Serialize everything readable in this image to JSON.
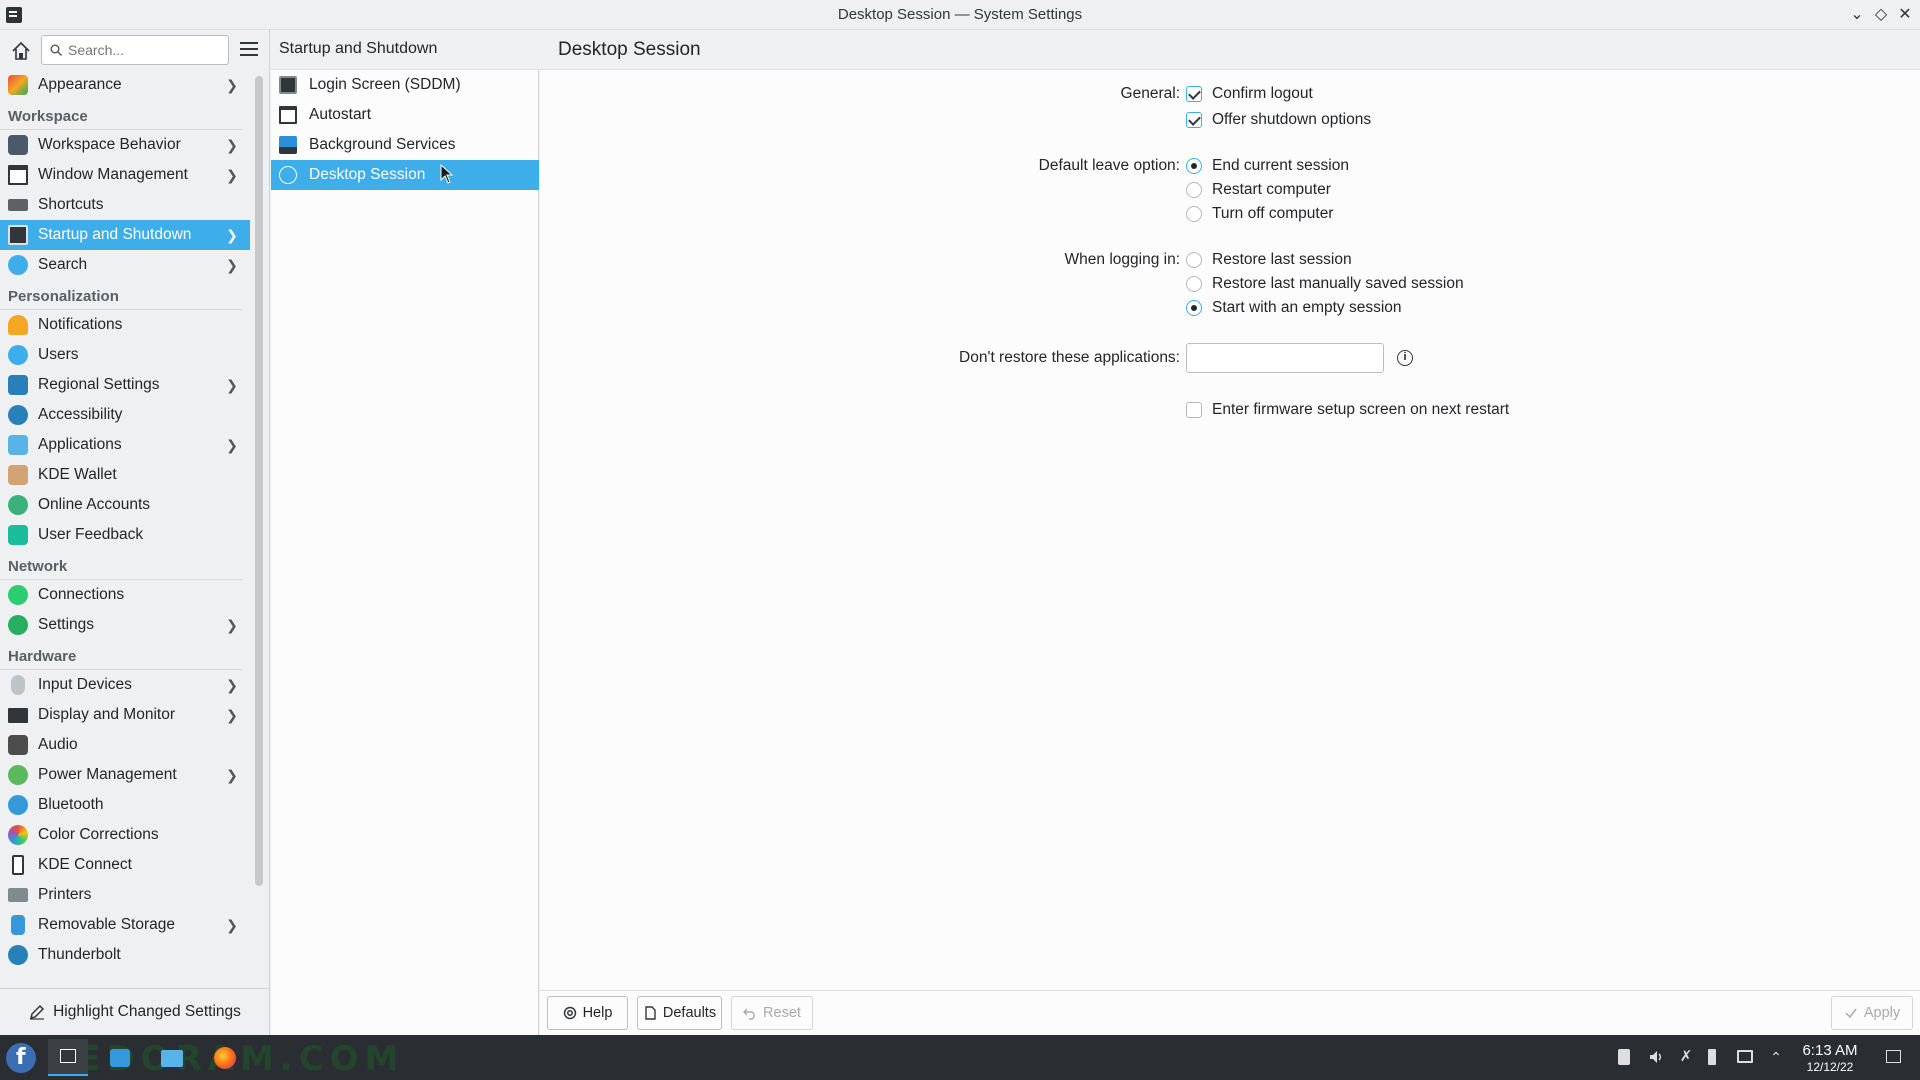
{
  "window": {
    "title": "Desktop Session — System Settings"
  },
  "search": {
    "placeholder": "Search..."
  },
  "sidebar": {
    "top_item": {
      "label": "Appearance"
    },
    "sections": {
      "workspace": "Workspace",
      "personalization": "Personalization",
      "network": "Network",
      "hardware": "Hardware"
    },
    "workspace_items": [
      {
        "label": "Workspace Behavior"
      },
      {
        "label": "Window Management"
      },
      {
        "label": "Shortcuts"
      },
      {
        "label": "Startup and Shutdown"
      },
      {
        "label": "Search"
      }
    ],
    "personalization_items": [
      {
        "label": "Notifications"
      },
      {
        "label": "Users"
      },
      {
        "label": "Regional Settings"
      },
      {
        "label": "Accessibility"
      },
      {
        "label": "Applications"
      },
      {
        "label": "KDE Wallet"
      },
      {
        "label": "Online Accounts"
      },
      {
        "label": "User Feedback"
      }
    ],
    "network_items": [
      {
        "label": "Connections"
      },
      {
        "label": "Settings"
      }
    ],
    "hardware_items": [
      {
        "label": "Input Devices"
      },
      {
        "label": "Display and Monitor"
      },
      {
        "label": "Audio"
      },
      {
        "label": "Power Management"
      },
      {
        "label": "Bluetooth"
      },
      {
        "label": "Color Corrections"
      },
      {
        "label": "KDE Connect"
      },
      {
        "label": "Printers"
      },
      {
        "label": "Removable Storage"
      },
      {
        "label": "Thunderbolt"
      }
    ],
    "footer_label": "Highlight Changed Settings"
  },
  "category": {
    "title": "Startup and Shutdown",
    "items": [
      {
        "label": "Login Screen (SDDM)"
      },
      {
        "label": "Autostart"
      },
      {
        "label": "Background Services"
      },
      {
        "label": "Desktop Session"
      }
    ]
  },
  "page": {
    "title": "Desktop Session",
    "general_label": "General:",
    "confirm_logout": "Confirm logout",
    "offer_shutdown": "Offer shutdown options",
    "leave_label": "Default leave option:",
    "leave_options": [
      "End current session",
      "Restart computer",
      "Turn off computer"
    ],
    "login_label": "When logging in:",
    "login_options": [
      "Restore last session",
      "Restore last manually saved session",
      "Start with an empty session"
    ],
    "dont_restore_label": "Don't restore these applications:",
    "dont_restore_value": "",
    "firmware_label": "Enter firmware setup screen on next restart",
    "info_icon_glyph": "i"
  },
  "buttons": {
    "help": "Help",
    "defaults": "Defaults",
    "reset": "Reset",
    "apply": "Apply"
  },
  "taskbar": {
    "time": "6:13 AM",
    "date": "12/12/22",
    "watermark": "FEDORAM.COM"
  },
  "colors": {
    "accent": "#3daee9",
    "taskbar": "#2a2e32"
  }
}
